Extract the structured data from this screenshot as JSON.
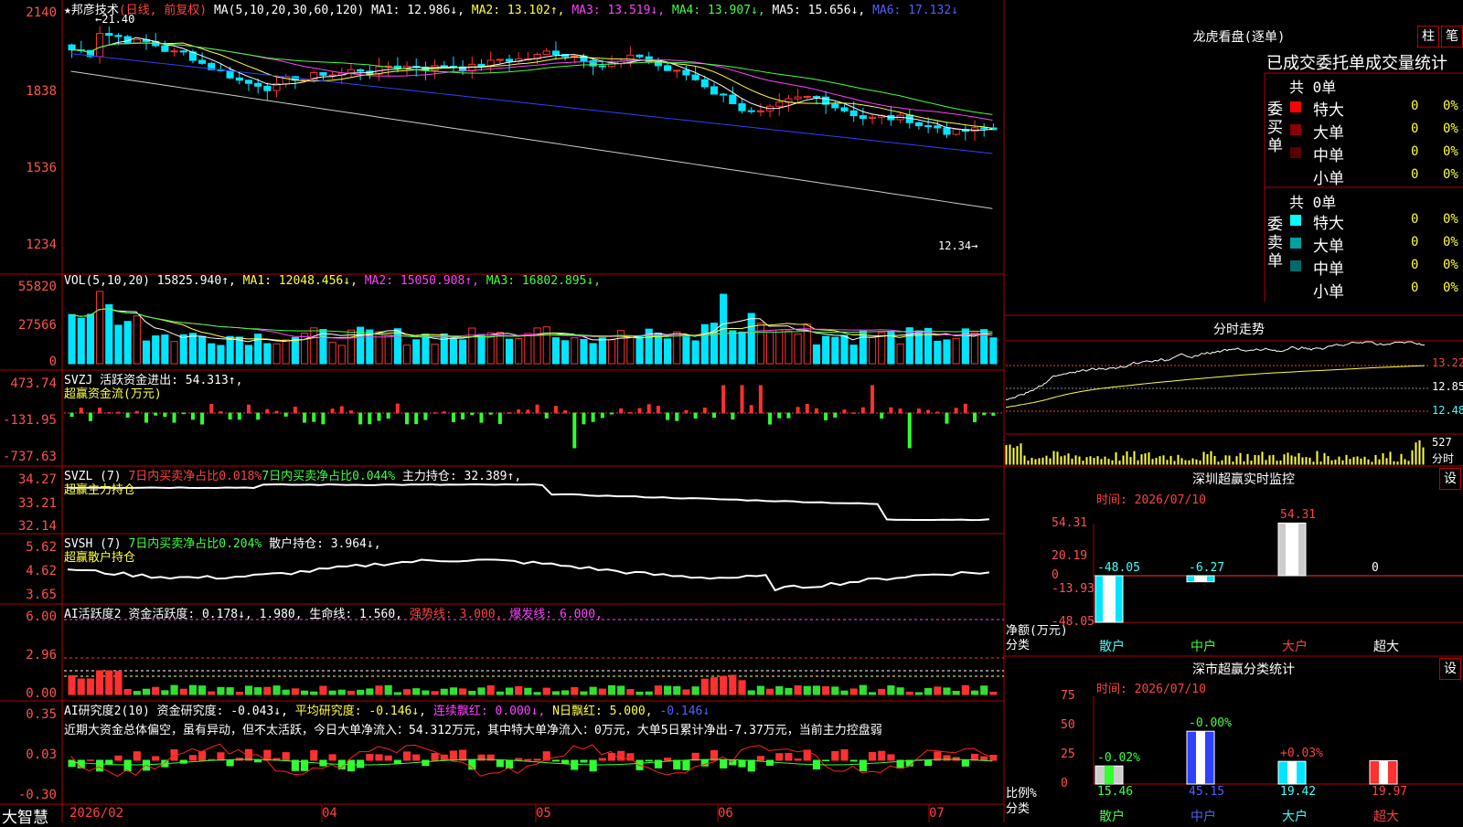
{
  "app": {
    "name": "大智慧",
    "date_axis": [
      "2026/02",
      "04",
      "05",
      "06",
      "07"
    ]
  },
  "kline": {
    "title": "★邦彦技术",
    "period": "(日线, 前复权)",
    "ma_params": "MA(5,10,20,30,60,120)",
    "ma1": "MA1: 12.986↓,",
    "ma2": "MA2: 13.102↑,",
    "ma3": "MA3: 13.519↓,",
    "ma4": "MA4: 13.907↓,",
    "ma5": "MA5: 15.656↓,",
    "ma6": "MA6: 17.132↓",
    "y_ticks": [
      "2140",
      "1838",
      "1536",
      "1234"
    ],
    "high_label": "←21.40",
    "low_label": "12.34→"
  },
  "vol": {
    "params": "VOL(5,10,20)",
    "value": "15825.940↑,",
    "ma1": "MA1: 12048.456↓,",
    "ma2": "MA2: 15050.908↑,",
    "ma3": "MA3: 16802.895↓,",
    "y_ticks": [
      "55820",
      "27566",
      "0"
    ]
  },
  "svzj": {
    "header": "SVZJ  活跃资金进出: 54.313↑,",
    "subtitle": "超赢资金流(万元)",
    "y_ticks": [
      "473.74",
      "-131.95",
      "-737.63"
    ]
  },
  "svzl": {
    "name": "SVZL (7)",
    "a": "7日内买卖净占比0.018%",
    "b": "7日内买卖净占比0.044%",
    "c": "主力持仓: 32.389↑,",
    "subtitle": "超赢主力持仓",
    "y_ticks": [
      "34.27",
      "33.21",
      "32.14"
    ]
  },
  "svsh": {
    "name": "SVSH (7)",
    "a": "7日内买卖净占比0.204%",
    "b": "散户持仓: 3.964↓,",
    "subtitle": "超赢散户持仓",
    "y_ticks": [
      "5.62",
      "4.62",
      "3.65"
    ]
  },
  "ai1": {
    "name": "AI活跃度2",
    "a": "资金活跃度: 0.178↓,",
    "b": "1.980,",
    "c": "生命线: 1.560,",
    "d": "强势线: 3.000,",
    "e": "爆发线: 6.000,",
    "y_ticks": [
      "6.00",
      "2.96",
      "0.00"
    ]
  },
  "ai2": {
    "name": "AI研究度2(10)",
    "a": "资金研究度: -0.043↓,",
    "b": "平均研究度: -0.146↓,",
    "c": "连续飘红: 0.000↓,",
    "d": "N日飘红: 5.000,",
    "e": "-0.146↓",
    "comment": "近期大资金总体偏空，虽有异动，但不太活跃，今日大单净流入：54.312万元，其中特大单净流入：0万元，大单5日累计净出-7.37万元，当前主力控盘弱",
    "y_ticks": [
      "0.35",
      "0.03",
      "-0.30"
    ]
  },
  "right": {
    "lhb_title": "龙虎看盘(逐单)",
    "btn_zhu": "柱",
    "btn_bi": "笔",
    "tabs_label": "已成交委托单成交量统计",
    "buy": {
      "side_label": "委买单",
      "count": "共 0单",
      "rows": [
        {
          "label": "特大",
          "num": "0",
          "pct": "0%",
          "color": "#ff0000"
        },
        {
          "label": "大单",
          "num": "0",
          "pct": "0%",
          "color": "#8a0000"
        },
        {
          "label": "中单",
          "num": "0",
          "pct": "0%",
          "color": "#5a0000"
        },
        {
          "label": "小单",
          "num": "0",
          "pct": "0%",
          "color": "#000000"
        }
      ]
    },
    "sell": {
      "side_label": "委卖单",
      "count": "共 0单",
      "rows": [
        {
          "label": "特大",
          "num": "0",
          "pct": "0%",
          "color": "#00ffff"
        },
        {
          "label": "大单",
          "num": "0",
          "pct": "0%",
          "color": "#00a0a0"
        },
        {
          "label": "中单",
          "num": "0",
          "pct": "0%",
          "color": "#006a6a"
        },
        {
          "label": "小单",
          "num": "0",
          "pct": "0%",
          "color": "#000000"
        }
      ]
    },
    "fenshi": {
      "title": "分时走势",
      "prices": [
        "13.22",
        "12.85",
        "12.48"
      ],
      "vol_label": "527",
      "vol_unit": "分时"
    },
    "sz_monitor": {
      "title": "深圳超赢实时监控",
      "btn": "设",
      "time": "时间: 2026/07/10",
      "y_ticks": [
        "54.31",
        "20.19",
        "0",
        "-13.93",
        "-48.05"
      ],
      "unit": "净额(万元)",
      "cat_label": "分类",
      "values": [
        "-48.05",
        "-6.27",
        "54.31",
        "0"
      ],
      "categories": [
        "散户",
        "中户",
        "大户",
        "超大"
      ]
    },
    "sz_stats": {
      "title": "深市超赢分类统计",
      "btn": "设",
      "time": "时间: 2026/07/10",
      "y_ticks": [
        "75",
        "50",
        "25",
        "0"
      ],
      "unit": "比例%",
      "cat_label": "分类",
      "deltas": [
        "-0.02%",
        "-0.00%",
        "+0.03%",
        ""
      ],
      "values": [
        "15.46",
        "45.15",
        "19.42",
        "19.97"
      ],
      "categories": [
        "散户",
        "中户",
        "大户",
        "超大"
      ]
    }
  }
}
